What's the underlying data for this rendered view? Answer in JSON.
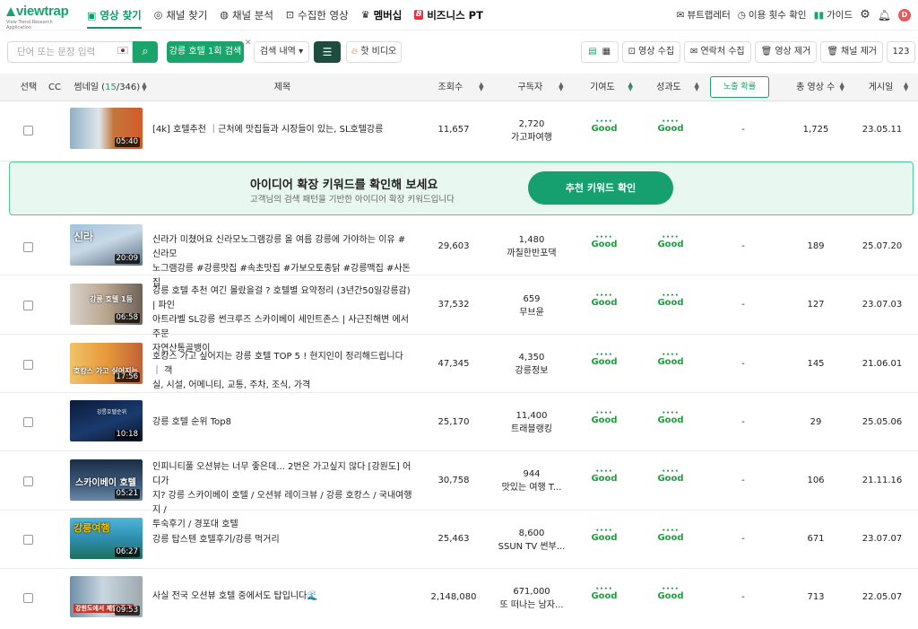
{
  "brand": {
    "name": "viewtrap",
    "tagline": "View Trend Research Application"
  },
  "nav": {
    "items": [
      {
        "label": "영상 찾기",
        "icon": "video-search-icon"
      },
      {
        "label": "채널 찾기",
        "icon": "channel-search-icon"
      },
      {
        "label": "채널 분석",
        "icon": "channel-analysis-icon"
      },
      {
        "label": "수집한 영상",
        "icon": "collected-icon"
      },
      {
        "label": "멤버십",
        "icon": "crown-icon"
      },
      {
        "label": "비즈니스 PT",
        "icon": "business-icon"
      }
    ],
    "right": {
      "newsletter": "뷰트랩레터",
      "usage": "이용 횟수 확인",
      "guide": "가이드",
      "avatar": "D"
    }
  },
  "toolbar": {
    "search_placeholder": "단어 또는 문장 입력",
    "search_tag": "강릉 호텔 1회 검색",
    "history": "검색 내역 ▾",
    "hot_video": "핫 비디오",
    "collect_video": "영상 수집",
    "collect_contact": "연락처 수집",
    "remove_video": "영상 제거",
    "remove_channel": "채널 제거",
    "count": "123"
  },
  "columns": {
    "select": "선택",
    "cc": "CC",
    "thumb": "썸네일 (",
    "thumb_count": "15",
    "thumb_total": "/346)",
    "title": "제목",
    "views": "조회수",
    "subs": "구독자",
    "contrib": "기여도",
    "perf": "성과도",
    "exposure": "노출 확률",
    "total": "총 영상 수",
    "date": "게시일"
  },
  "banner": {
    "title": "아이디어 확장 키워드를 확인해 보세요",
    "subtitle": "고객님의 검색 패턴을 기반한 아이디어 확장 키워드입니다",
    "button": "추천 키워드 확인"
  },
  "good_label": "Good",
  "rows": [
    {
      "duration": "05:40",
      "title": [
        "[4k] 호텔추천 ｜근처에 맛집들과 시장들이 있는, SL호텔강릉"
      ],
      "views": "11,657",
      "subs": "2,720",
      "channel": "가고파여행",
      "exposure": "-",
      "total": "1,725",
      "date": "23.05.11"
    },
    {
      "duration": "20:09",
      "title": [
        "신라가 미쳤어요 신라모노그램강릉 올 여름 강릉에 가야하는 이유 #신라모",
        "노그램강릉 #강릉맛집 #속초맛집 #가보오토종닭 #강릉맥집 #사돈집"
      ],
      "views": "29,603",
      "subs": "1,480",
      "channel": "까칠한반포댁",
      "exposure": "-",
      "total": "189",
      "date": "25.07.20"
    },
    {
      "duration": "06:58",
      "title": [
        "강릉 호텔 추천 여긴 몰랐을걸 ? 호텔별 요약정리 (3년간50일강릉감) | 파인",
        "아트라벨 SL강릉 썬크루즈 스카이베이 세인트존스 | 사근진해변 에서 주문",
        "자연산통골뱅이"
      ],
      "views": "37,532",
      "subs": "659",
      "channel": "무브윤",
      "exposure": "-",
      "total": "127",
      "date": "23.07.03"
    },
    {
      "duration": "17:56",
      "title": [
        "호캉스 가고 싶어지는 강릉 호텔 TOP 5 ! 현지인이 정리해드립니다 ｜ 객",
        "실, 시설, 어메니티, 교통, 주차, 조식, 가격"
      ],
      "views": "47,345",
      "subs": "4,350",
      "channel": "강릉정보",
      "exposure": "-",
      "total": "145",
      "date": "21.06.01"
    },
    {
      "duration": "10:18",
      "title": [
        "강릉 호텔 순위 Top8"
      ],
      "views": "25,170",
      "subs": "11,400",
      "channel": "트래블랭킹",
      "exposure": "-",
      "total": "29",
      "date": "25.05.06"
    },
    {
      "duration": "05:21",
      "title": [
        "인피니티풀 오션뷰는 너무 좋은데... 2번은 가고싶지 않다 [강원도] 어디가",
        "지? 강릉 스카이베이 호텔 / 오션뷰 레이크뷰 / 강릉 호캉스 / 국내여행지 /",
        "투숙후기 / 경포대 호텔"
      ],
      "views": "30,758",
      "subs": "944",
      "channel": "맛있는 여행 T...",
      "exposure": "-",
      "total": "106",
      "date": "21.11.16"
    },
    {
      "duration": "06:27",
      "title": [
        "강릉 탑스텐 호텔후기/강릉 먹거리"
      ],
      "views": "25,463",
      "subs": "8,600",
      "channel": "SSUN TV 썬부...",
      "exposure": "-",
      "total": "671",
      "date": "23.07.07"
    },
    {
      "duration": "09:53",
      "title": [
        "사실 전국 오션뷰 호텔 중에서도 탑입니다🌊"
      ],
      "views": "2,148,080",
      "subs": "671,000",
      "channel": "또 떠나는 남자...",
      "exposure": "-",
      "total": "713",
      "date": "22.05.07"
    }
  ]
}
